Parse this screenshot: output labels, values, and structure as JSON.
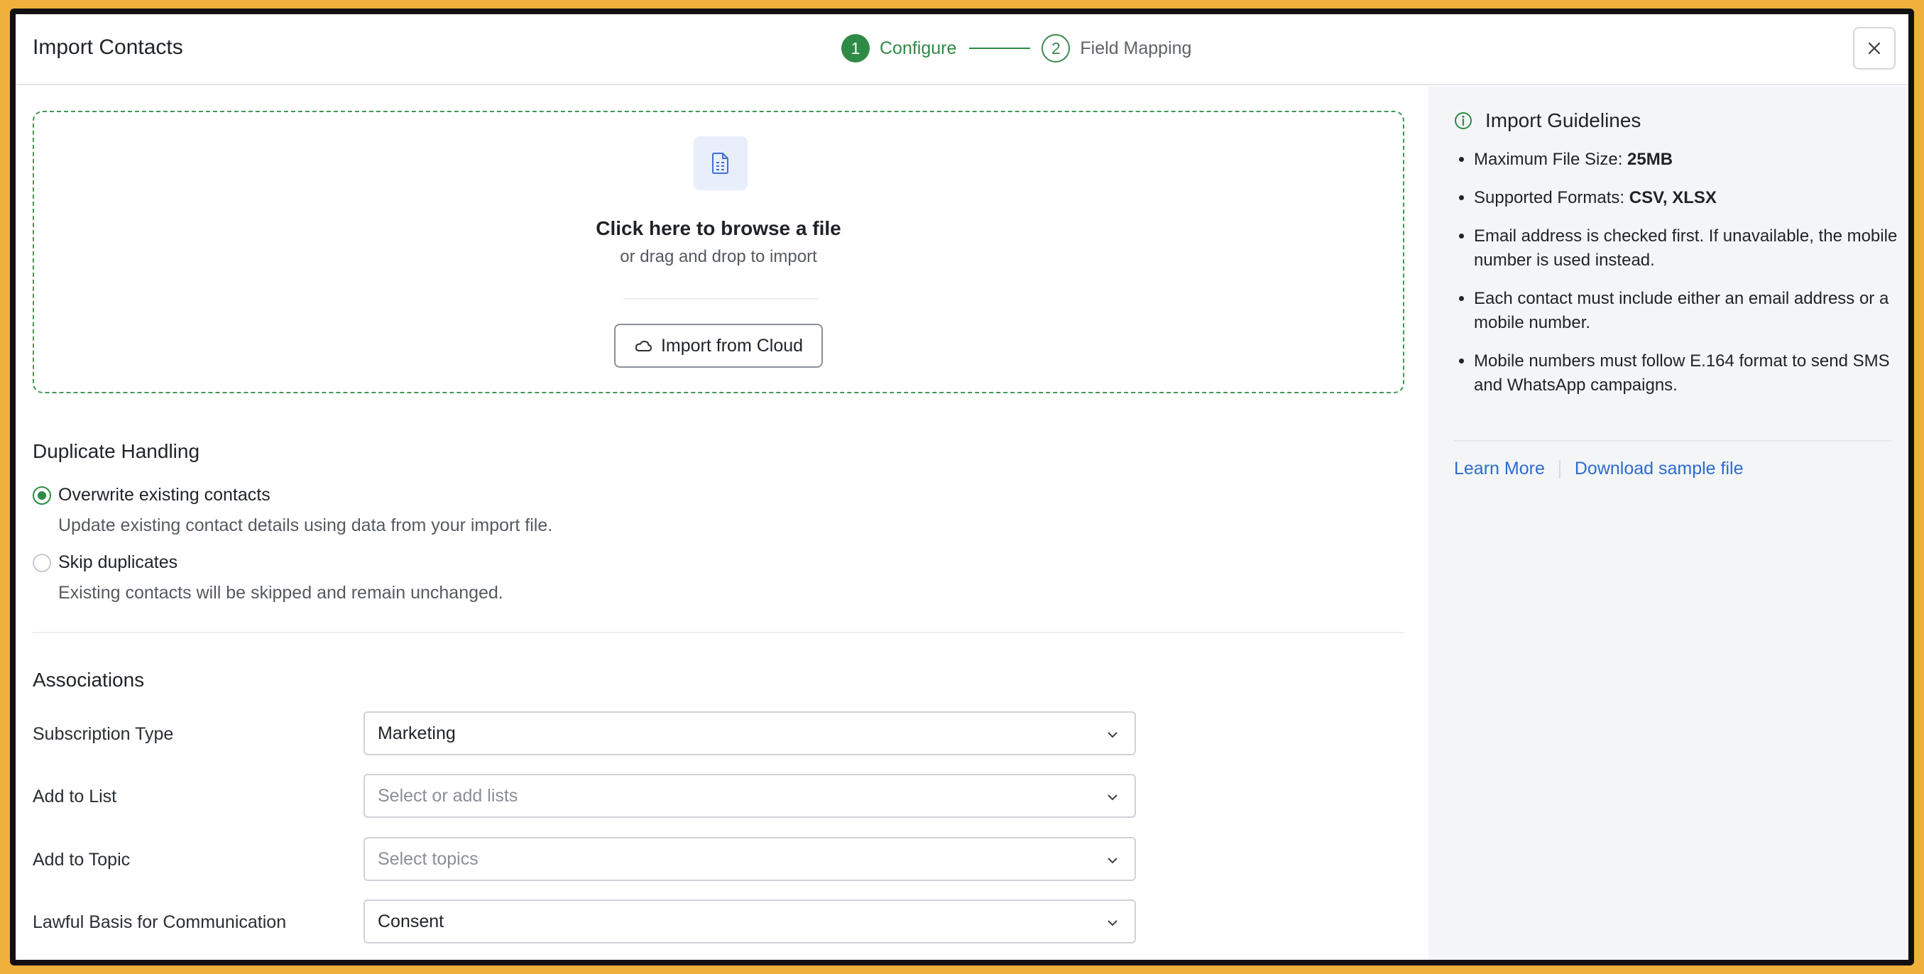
{
  "dialog": {
    "title": "Import Contacts",
    "close_icon": "close-icon"
  },
  "stepper": {
    "steps": [
      {
        "number": "1",
        "label": "Configure",
        "state": "active"
      },
      {
        "number": "2",
        "label": "Field Mapping",
        "state": "inactive"
      }
    ]
  },
  "upload": {
    "icon": "file-document-icon",
    "title": "Click here to browse a file",
    "subtitle": "or drag and drop to import",
    "cloud_button": "Import from Cloud",
    "cloud_icon": "cloud-icon"
  },
  "duplicate": {
    "heading": "Duplicate Handling",
    "options": [
      {
        "label": "Overwrite existing contacts",
        "description": "Update existing contact details using data from your import file.",
        "checked": true
      },
      {
        "label": "Skip duplicates",
        "description": "Existing contacts will be skipped and remain unchanged.",
        "checked": false
      }
    ]
  },
  "associations": {
    "heading": "Associations",
    "fields": [
      {
        "label": "Subscription Type",
        "value": "Marketing",
        "placeholder": ""
      },
      {
        "label": "Add to List",
        "value": "",
        "placeholder": "Select or add lists"
      },
      {
        "label": "Add to Topic",
        "value": "",
        "placeholder": "Select topics"
      },
      {
        "label": "Lawful Basis for Communication",
        "value": "Consent",
        "placeholder": ""
      }
    ]
  },
  "guidelines": {
    "icon": "info-icon",
    "title": "Import Guidelines",
    "items": [
      {
        "text": "Maximum File Size: ",
        "bold": "25MB"
      },
      {
        "text": "Supported Formats: ",
        "bold": "CSV, XLSX"
      },
      {
        "text": "Email address is checked first. If unavailable, the mobile number is used instead.",
        "bold": ""
      },
      {
        "text": "Each contact must include either an email address or a mobile number.",
        "bold": ""
      },
      {
        "text": "Mobile numbers must follow E.164 format to send SMS and WhatsApp campaigns.",
        "bold": ""
      }
    ],
    "learn_more": "Learn More",
    "download_sample": "Download sample file"
  },
  "colors": {
    "accent_green": "#2f8a45",
    "link_blue": "#2c6bd1",
    "outer_border": "#f0b13c"
  }
}
